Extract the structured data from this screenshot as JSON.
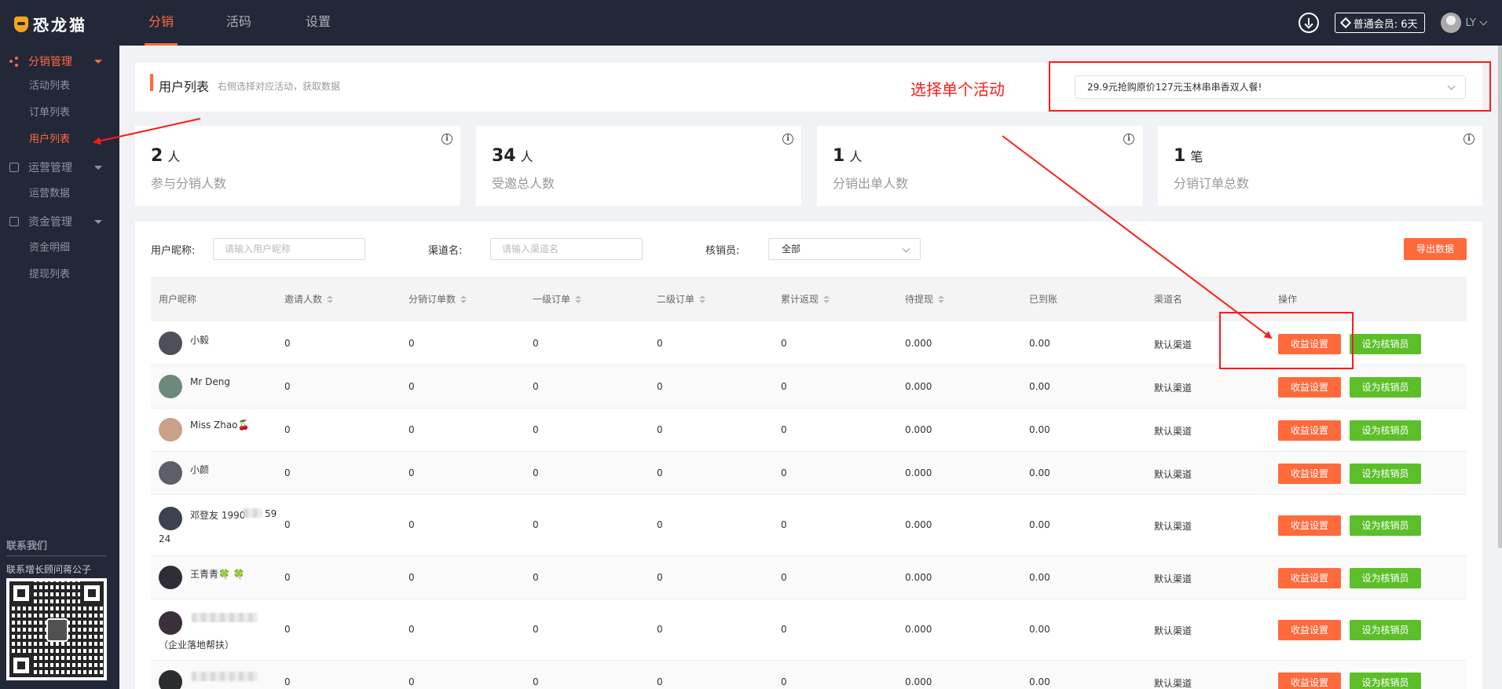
{
  "app": {
    "logo_text": "恐龙猫",
    "nav_tabs": [
      {
        "label": "分销"
      },
      {
        "label": "活码"
      },
      {
        "label": "设置"
      }
    ],
    "membership": "普通会员: 6天",
    "user_name": "LY"
  },
  "sidebar": {
    "groups": [
      {
        "label": "分销管理",
        "items": [
          "活动列表",
          "订单列表",
          "用户列表"
        ]
      },
      {
        "label": "运营管理",
        "items": [
          "运营数据"
        ]
      },
      {
        "label": "资金管理",
        "items": [
          "资金明细",
          "提现列表"
        ]
      }
    ],
    "contact_title": "联系我们",
    "contact_sub": "联系增长顾问蒋公子"
  },
  "header": {
    "title": "用户列表",
    "subtitle": "右侧选择对应活动，获取数据",
    "activity_selected": "29.9元抢购原价127元玉林串串香双人餐!"
  },
  "annotation": {
    "text": "选择单个活动"
  },
  "stats": [
    {
      "value": "2",
      "unit": "人",
      "label": "参与分销人数"
    },
    {
      "value": "34",
      "unit": "人",
      "label": "受邀总人数"
    },
    {
      "value": "1",
      "unit": "人",
      "label": "分销出单人数"
    },
    {
      "value": "1",
      "unit": "笔",
      "label": "分销订单总数"
    }
  ],
  "filters": {
    "nickname_label": "用户昵称:",
    "nickname_placeholder": "请输入用户昵称",
    "channel_label": "渠道名:",
    "channel_placeholder": "请输入渠道名",
    "verifier_label": "核销员:",
    "verifier_value": "全部",
    "export_label": "导出数据"
  },
  "table": {
    "columns": [
      "用户昵称",
      "邀请人数",
      "分销订单数",
      "一级订单",
      "二级订单",
      "累计返现",
      "待提现",
      "已到账",
      "渠道名",
      "操作"
    ],
    "action_primary": "收益设置",
    "action_secondary": "设为核销员",
    "rows": [
      {
        "nickname": "小毅",
        "invited": "0",
        "orders": "0",
        "level1": "0",
        "level2": "0",
        "cashback": "0",
        "pending": "0.000",
        "received": "0.00",
        "channel": "默认渠道"
      },
      {
        "nickname": "Mr Deng",
        "invited": "0",
        "orders": "0",
        "level1": "0",
        "level2": "0",
        "cashback": "0",
        "pending": "0.000",
        "received": "0.00",
        "channel": "默认渠道"
      },
      {
        "nickname": "Miss Zhao🍒",
        "invited": "0",
        "orders": "0",
        "level1": "0",
        "level2": "0",
        "cashback": "0",
        "pending": "0.000",
        "received": "0.00",
        "channel": "默认渠道"
      },
      {
        "nickname": "小颜",
        "invited": "0",
        "orders": "0",
        "level1": "0",
        "level2": "0",
        "cashback": "0",
        "pending": "0.000",
        "received": "0.00",
        "channel": "默认渠道"
      },
      {
        "nickname": "邓登友 1990",
        "nickname_suffix": "59",
        "nickname_line2": "24",
        "invited": "0",
        "orders": "0",
        "level1": "0",
        "level2": "0",
        "cashback": "0",
        "pending": "0.000",
        "received": "0.00",
        "channel": "默认渠道"
      },
      {
        "nickname": "王青青🍀 🍀",
        "invited": "0",
        "orders": "0",
        "level1": "0",
        "level2": "0",
        "cashback": "0",
        "pending": "0.000",
        "received": "0.00",
        "channel": "默认渠道"
      },
      {
        "nickname_line2": "（企业落地帮扶）",
        "invited": "0",
        "orders": "0",
        "level1": "0",
        "level2": "0",
        "cashback": "0",
        "pending": "0.000",
        "received": "0.00",
        "channel": "默认渠道"
      },
      {
        "invited": "0",
        "orders": "0",
        "level1": "0",
        "level2": "0",
        "cashback": "0",
        "pending": "0.000",
        "received": "0.00",
        "channel": "默认渠道"
      }
    ]
  },
  "colors": {
    "accent": "#ff6a3d",
    "green": "#5cbf2a",
    "annotation_red": "#ff1a1a",
    "topbar": "#232838"
  }
}
